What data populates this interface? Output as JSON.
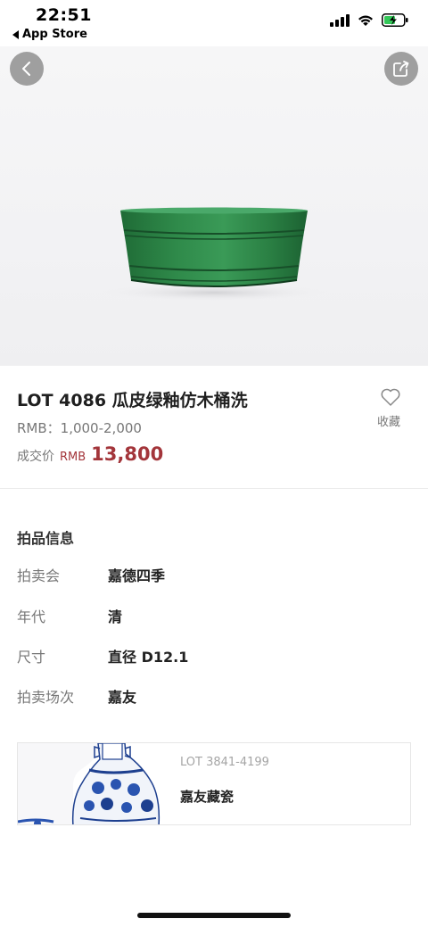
{
  "status": {
    "time": "22:51",
    "back_app": "App Store"
  },
  "hero": {
    "back_icon": "chevron-left-icon",
    "share_icon": "share-icon"
  },
  "lot": {
    "title": "LOT 4086 瓜皮绿釉仿木桶洗",
    "estimate": "RMB：1,000-2,000",
    "deal_label": "成交价",
    "deal_currency": "RMB",
    "deal_price": "13,800",
    "favorite_label": "收藏"
  },
  "details": {
    "section_title": "拍品信息",
    "rows": [
      {
        "key": "拍卖会",
        "value": "嘉德四季"
      },
      {
        "key": "年代",
        "value": "清"
      },
      {
        "key": "尺寸",
        "value": "直径 D12.1"
      },
      {
        "key": "拍卖场次",
        "value": "嘉友"
      }
    ]
  },
  "card": {
    "lot_range": "LOT 3841-4199",
    "name": "嘉友藏瓷"
  },
  "colors": {
    "price": "#a3353a",
    "glaze_green": "#2f8a4a"
  }
}
